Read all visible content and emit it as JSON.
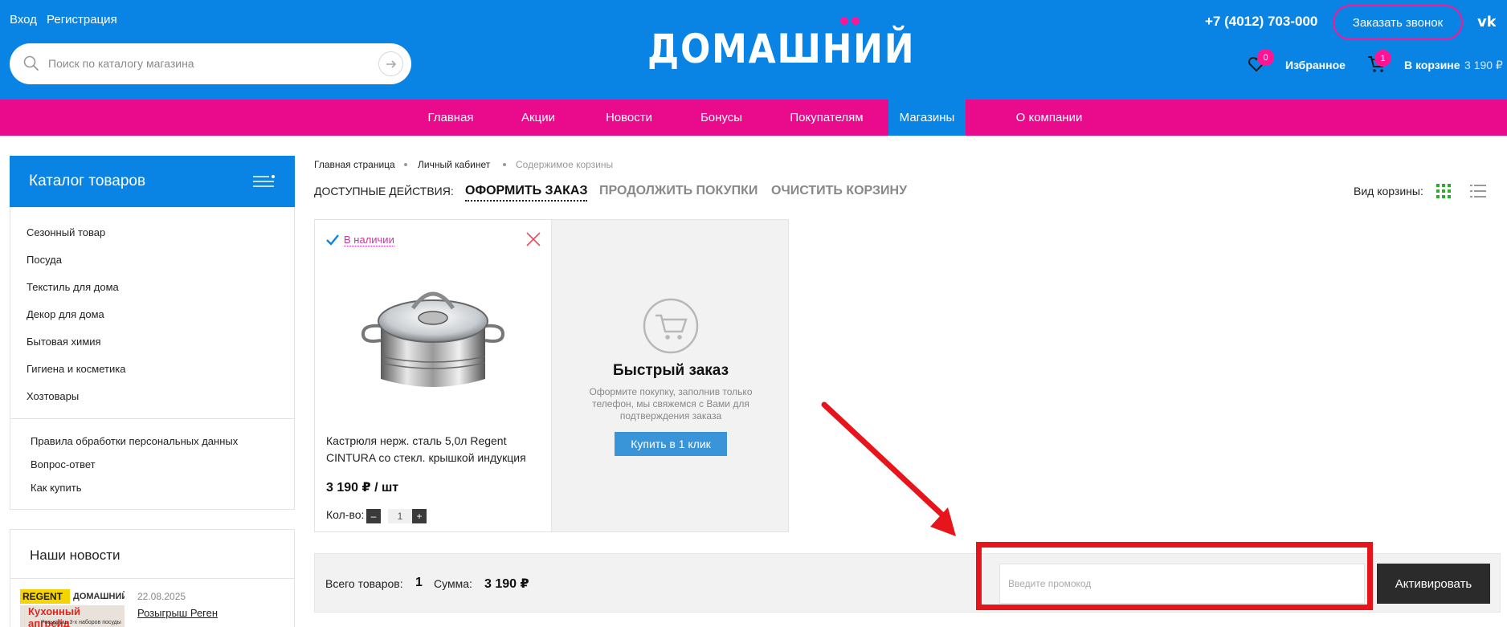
{
  "header": {
    "login": "Вход",
    "register": "Регистрация",
    "search_placeholder": "Поиск по каталогу магазина",
    "logo_text": "ДОМАШНИЙ",
    "phone": "+7 (4012) 703-000",
    "callback_label": "Заказать звонок",
    "favorites_count": "0",
    "favorites_label": "Избранное",
    "cart_count": "1",
    "cart_label": "В корзине",
    "cart_sum": "3 190 ₽",
    "accent_color": "#0a84e4",
    "brand_pink": "#ea0a8c"
  },
  "nav": {
    "items": [
      "Главная",
      "Акции",
      "Новости",
      "Бонусы",
      "Покупателям",
      "Магазины",
      "О компании"
    ],
    "active": "Магазины"
  },
  "sidebar": {
    "catalog_title": "Каталог товаров",
    "categories": [
      "Сезонный товар",
      "Посуда",
      "Текстиль для дома",
      "Декор для дома",
      "Бытовая химия",
      "Гигиена и косметика",
      "Хозтовары"
    ],
    "info_links": [
      "Правила обработки персональных данных",
      "Вопрос-ответ",
      "Как купить"
    ],
    "news_title": "Наши новости",
    "news": {
      "date": "22.08.2025",
      "link": "Розыгрыш Реген",
      "image_brand": "REGENT",
      "image_logo": "ДОМАШНИЙ",
      "image_caption": "Кухонный апгрейд",
      "image_sub": "Розыгрыш 3-х наборов посуды"
    }
  },
  "breadcrumb": [
    "Главная страница",
    "Личный кабинет",
    "Содержимое корзины"
  ],
  "actions": {
    "label": "ДОСТУПНЫЕ ДЕЙСТВИЯ:",
    "checkout": "ОФОРМИТЬ ЗАКАЗ",
    "continue": "ПРОДОЛЖИТЬ ПОКУПКИ",
    "clear": "ОЧИСТИТЬ КОРЗИНУ",
    "view_label": "Вид корзины:"
  },
  "product": {
    "stock": "В наличии",
    "name": "Кастрюля нерж. сталь 5,0л Regent CINTURA со стекл. крышкой индукция",
    "price": "3 190 ₽ / шт",
    "qty_label": "Кол-во:",
    "qty": "1",
    "minus": "–",
    "plus": "+"
  },
  "quick_order": {
    "title": "Быстрый заказ",
    "description": "Оформите покупку, заполнив только телефон, мы свяжемся с Вами для подтверждения заказа",
    "button": "Купить в 1 клик"
  },
  "summary": {
    "total_items_label": "Всего товаров:",
    "total_items": "1",
    "sum_label": "Сумма:",
    "sum": "3 190 ₽",
    "promo_placeholder": "Введите промокод",
    "activate": "Активировать"
  },
  "annotation_color": "#e8141c"
}
